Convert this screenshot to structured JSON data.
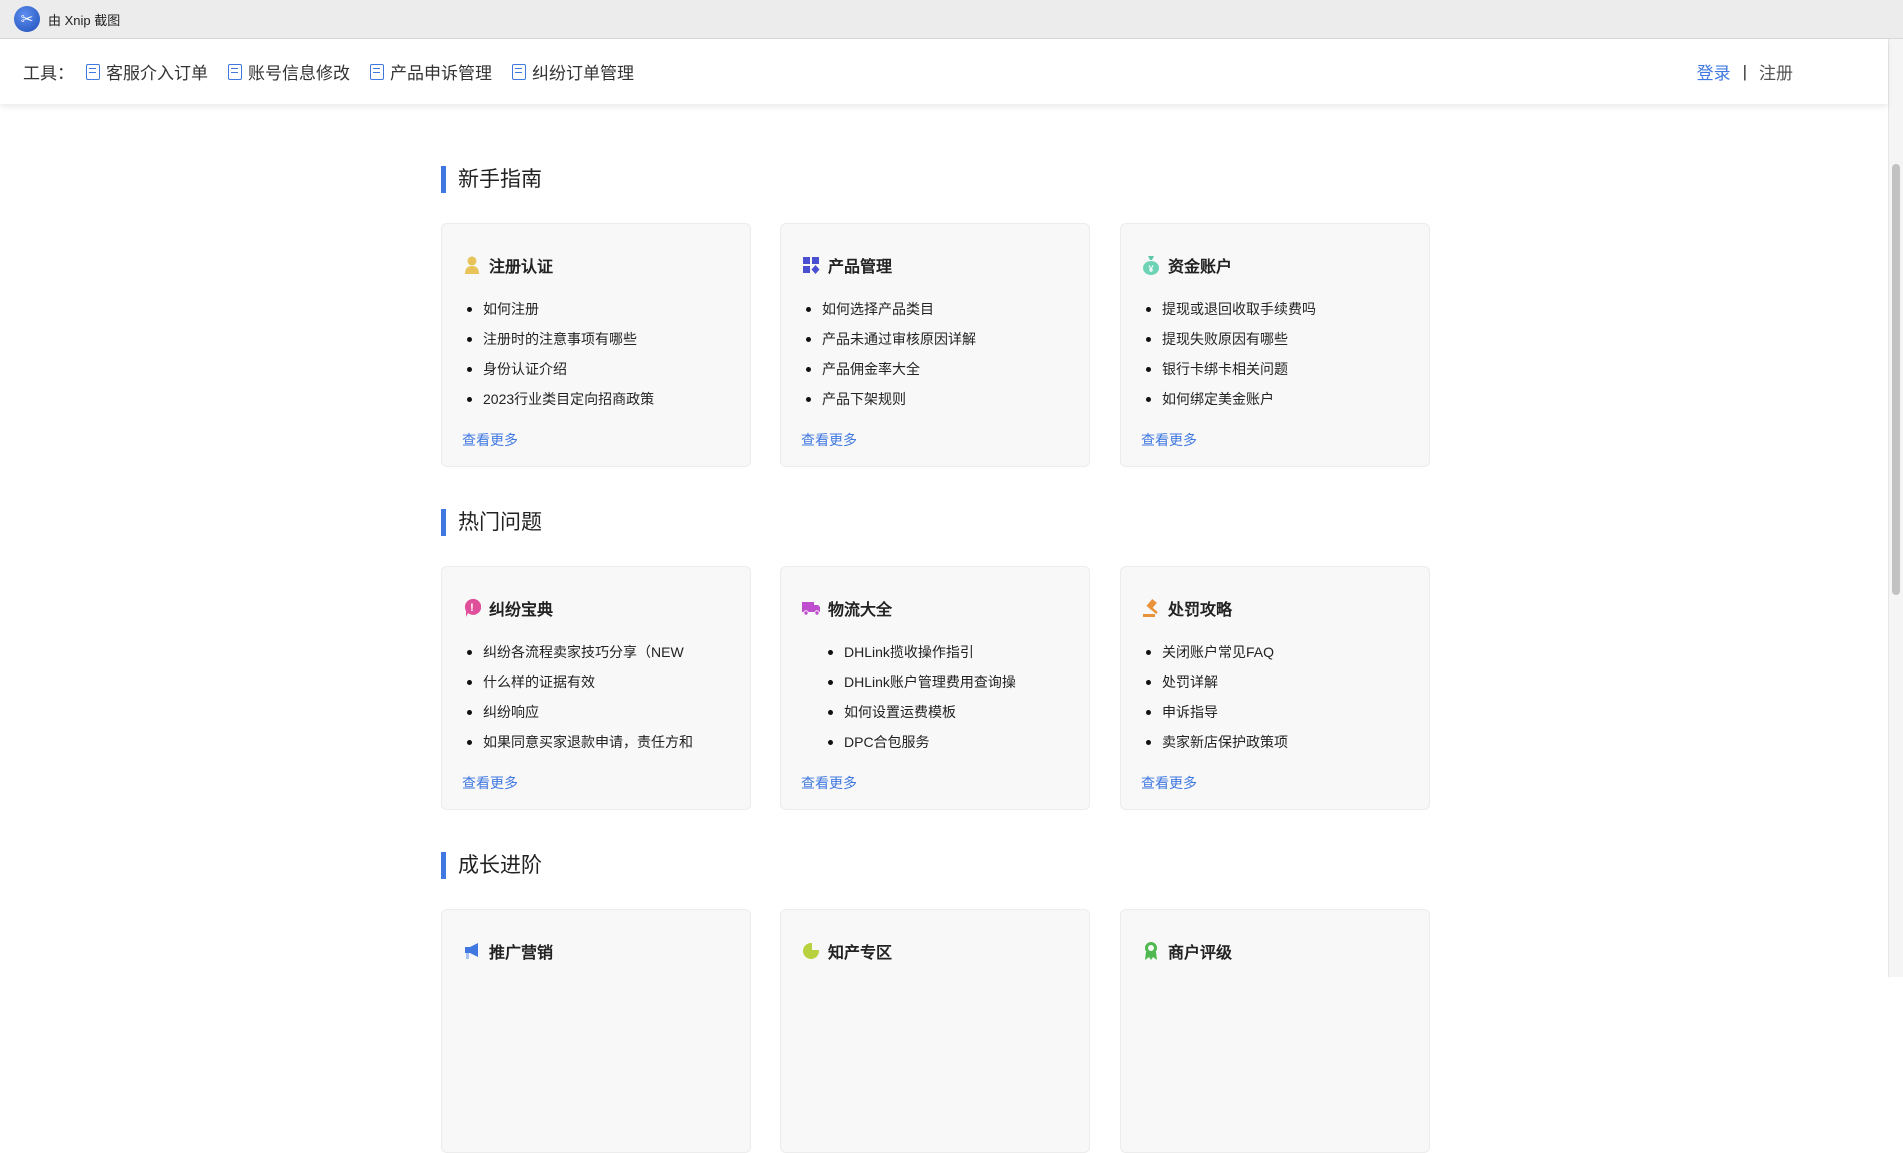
{
  "window": {
    "title": "由 Xnip 截图"
  },
  "toolbar": {
    "label": "工具：",
    "tools": [
      "客服介入订单",
      "账号信息修改",
      "产品申诉管理",
      "纠纷订单管理"
    ],
    "login": "登录",
    "separator": "|",
    "register": "注册"
  },
  "colors": {
    "accent": "#3f78e0"
  },
  "sections": [
    {
      "title": "新手指南",
      "cards": [
        {
          "title": "注册认证",
          "icon": "user-icon",
          "items": [
            "如何注册",
            "注册时的注意事项有哪些",
            "身份认证介绍",
            "2023行业类目定向招商政策"
          ],
          "more": "查看更多"
        },
        {
          "title": "产品管理",
          "icon": "grid-icon",
          "items": [
            "如何选择产品类目",
            "产品未通过审核原因详解",
            "产品佣金率大全",
            "产品下架规则"
          ],
          "more": "查看更多"
        },
        {
          "title": "资金账户",
          "icon": "money-bag-icon",
          "items": [
            "提现或退回收取手续费吗",
            "提现失败原因有哪些",
            "银行卡绑卡相关问题",
            "如何绑定美金账户"
          ],
          "more": "查看更多"
        }
      ]
    },
    {
      "title": "热门问题",
      "cards": [
        {
          "title": "纠纷宝典",
          "icon": "alert-chat-icon",
          "items": [
            "纠纷各流程卖家技巧分享（NEW",
            "什么样的证据有效",
            "纠纷响应",
            "如果同意买家退款申请，责任方和"
          ],
          "more": "查看更多"
        },
        {
          "title": "物流大全",
          "icon": "truck-icon",
          "items": [
            "DHLink揽收操作指引",
            "DHLink账户管理费用查询操",
            "如何设置运费模板",
            "DPC合包服务"
          ],
          "more": "查看更多"
        },
        {
          "title": "处罚攻略",
          "icon": "gavel-icon",
          "items": [
            "关闭账户常见FAQ",
            "处罚详解",
            "申诉指导",
            "卖家新店保护政策项"
          ],
          "more": "查看更多"
        }
      ]
    },
    {
      "title": "成长进阶",
      "cards": [
        {
          "title": "推广营销",
          "icon": "megaphone-icon"
        },
        {
          "title": "知产专区",
          "icon": "pie-chart-icon"
        },
        {
          "title": "商户评级",
          "icon": "award-icon"
        }
      ]
    }
  ]
}
